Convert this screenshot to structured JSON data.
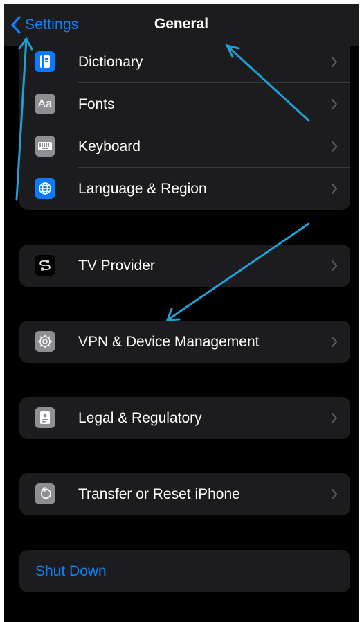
{
  "colors": {
    "accent": "#0a84ff",
    "background": "#000000",
    "group_background": "#1c1c1e",
    "annotation_arrow": "#1f9fd6"
  },
  "navbar": {
    "back_label": "Settings",
    "back_icon": "chevron-left-icon",
    "title": "General"
  },
  "groups": [
    {
      "items": [
        {
          "label": "Dictionary",
          "icon": "dictionary-icon"
        },
        {
          "label": "Fonts",
          "icon": "fonts-icon"
        },
        {
          "label": "Keyboard",
          "icon": "keyboard-icon"
        },
        {
          "label": "Language & Region",
          "icon": "globe-icon"
        }
      ]
    },
    {
      "items": [
        {
          "label": "TV Provider",
          "icon": "tv-provider-icon"
        }
      ]
    },
    {
      "items": [
        {
          "label": "VPN & Device Management",
          "icon": "gear-icon"
        }
      ]
    },
    {
      "items": [
        {
          "label": "Legal & Regulatory",
          "icon": "legal-icon"
        }
      ]
    },
    {
      "items": [
        {
          "label": "Transfer or Reset iPhone",
          "icon": "reset-icon"
        }
      ]
    },
    {
      "items": [
        {
          "label": "Shut Down"
        }
      ]
    }
  ],
  "fonts_icon_text": "Aa"
}
